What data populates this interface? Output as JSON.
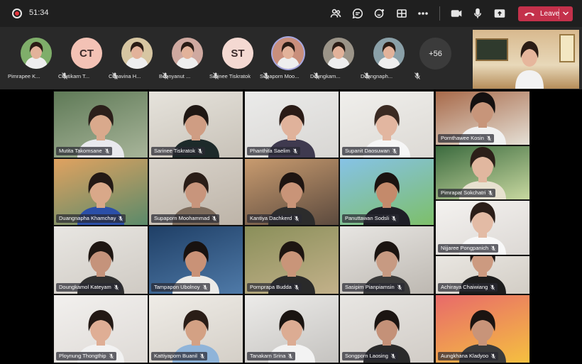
{
  "meeting": {
    "timer": "51:34",
    "leave_label": "Leave",
    "colors": {
      "toolbar_bg": "#1f1f1f",
      "strip_bg": "#292929",
      "leave_red": "#c4314b",
      "active_ring": "#a6a7e0"
    }
  },
  "toolbar": {
    "icons": [
      "participants-icon",
      "chat-icon",
      "reactions-icon",
      "rooms-icon",
      "more-options-icon",
      "camera-icon",
      "mic-icon",
      "share-icon"
    ]
  },
  "roster": {
    "items": [
      {
        "name": "Pimrapee K...",
        "initials": "",
        "avatar_color": "#7fae6a",
        "photo": true
      },
      {
        "name": "Chutikarn T...",
        "initials": "CT",
        "avatar_color": "#f3c2b5",
        "photo": false
      },
      {
        "name": "Chpavina H...",
        "initials": "",
        "avatar_color": "#d7c6a2",
        "photo": true
      },
      {
        "name": "Boonyanut ...",
        "initials": "",
        "avatar_color": "#cfa9a0",
        "photo": true
      },
      {
        "name": "Sarinee Tiskratok",
        "initials": "ST",
        "avatar_color": "#f4d9d2",
        "photo": false
      },
      {
        "name": "Supaporn Moo...",
        "initials": "",
        "avatar_color": "#c98f7c",
        "photo": true,
        "active": true
      },
      {
        "name": "Doungkam...",
        "initials": "",
        "avatar_color": "#9b9488",
        "photo": true
      },
      {
        "name": "Duangnaph...",
        "initials": "",
        "avatar_color": "#8aa0a8",
        "photo": true
      }
    ],
    "more_count": "+56"
  },
  "grid": {
    "tiles": [
      {
        "name": "Mutita Takomsane",
        "bg": "#5f7a57",
        "bg2": "#a8b59a",
        "skin": "#d9a98c",
        "hair": "#2b1f1a",
        "shirt": "#e9e9ee",
        "speaking": true
      },
      {
        "name": "Sarinee Tiskratok",
        "bg": "#e6e3dc",
        "bg2": "#c8c2b8",
        "skin": "#cf9d83",
        "hair": "#1f1713",
        "shirt": "#1d2a2a"
      },
      {
        "name": "Phanthita Saelim",
        "bg": "#ebebea",
        "bg2": "#d8d6d3",
        "skin": "#e0b29b",
        "hair": "#2a1b16",
        "shirt": "#3f3a4f"
      },
      {
        "name": "Supanit Daosuwan",
        "bg": "#f0efec",
        "bg2": "#dcd9d4",
        "skin": "#e2b6a0",
        "hair": "#3a2a22",
        "shirt": "#f6f6f6"
      },
      {
        "name": "Pornthawee Kosin",
        "bg": "#a86a4a",
        "bg2": "#e5e0d6",
        "skin": "#c7957a",
        "hair": "#141010",
        "shirt": "#f1f1f1"
      },
      {
        "name": "Duangnapha Khamchay",
        "bg": "#e0a260",
        "bg2": "#5a8a6a",
        "skin": "#d9a889",
        "hair": "#231915",
        "shirt": "#2b4fa8"
      },
      {
        "name": "Supaporn Moohammad",
        "bg": "#d9d3cb",
        "bg2": "#bdb4a8",
        "skin": "#c8957c",
        "hair": "#2a1d17",
        "shirt": "#7c6b5c"
      },
      {
        "name": "Kantiya Dachkerd",
        "bg": "#c89b6f",
        "bg2": "#5c4a3e",
        "skin": "#c99478",
        "hair": "#1d1411",
        "shirt": "#2c2c2c"
      },
      {
        "name": "Panuttawan Sodsli",
        "bg": "#86c2e6",
        "bg2": "#7dbf69",
        "skin": "#c48a6b",
        "hair": "#1b1310",
        "shirt": "#1e1e26"
      },
      {
        "name": "Pimrapat Sokchatri",
        "bg": "#3c6b3f",
        "bg2": "#c8d8a0",
        "skin": "#e1b79f",
        "hair": "#2c1f19",
        "shirt": "#e7e1cf"
      },
      {
        "name": "Nijjaree Pongpanich",
        "bg": "#f4f2f0",
        "bg2": "#dcd8d4",
        "skin": "#e3bba5",
        "hair": "#2b1e19",
        "shirt": "#f8f8f8"
      },
      {
        "name": "Doungkamol Kateyam",
        "bg": "#e8e6e2",
        "bg2": "#cfcac3",
        "skin": "#c5937b",
        "hair": "#1e1612",
        "shirt": "#303030"
      },
      {
        "name": "Tampapon Ubolnoy",
        "bg": "#1f3f66",
        "bg2": "#4f7aa8",
        "skin": "#c99277",
        "hair": "#181210",
        "shirt": "#ecebe8"
      },
      {
        "name": "Pornprapa Budda",
        "bg": "#8a8f5a",
        "bg2": "#c3b18a",
        "skin": "#c99579",
        "hair": "#1d1511",
        "shirt": "#2a2a2a"
      },
      {
        "name": "Sasipim Pianpiamsin",
        "bg": "#e7e5e2",
        "bg2": "#bdb8b1",
        "skin": "#c79a82",
        "hair": "#1b1411",
        "shirt": "#3a3a3a"
      },
      {
        "name": "Achiraya Chaiwiang",
        "bg": "#e9e6e1",
        "bg2": "#d2cdc5",
        "skin": "#cc9a80",
        "hair": "#1c1411",
        "shirt": "#1d1d1d"
      },
      {
        "name": "Ploynung Thongthip",
        "bg": "#f2f0ee",
        "bg2": "#dedad6",
        "skin": "#dfae95",
        "hair": "#231915",
        "shirt": "#f2f2f2"
      },
      {
        "name": "Kattiyaporn Buanil",
        "bg": "#efece7",
        "bg2": "#d4cfc7",
        "skin": "#d3a184",
        "hair": "#2a1d17",
        "shirt": "#8fb4d9"
      },
      {
        "name": "Tanakarn Srina",
        "bg": "#ecebe9",
        "bg2": "#c5c3c0",
        "skin": "#dcac93",
        "hair": "#1a1411",
        "shirt": "#f3f3f3"
      },
      {
        "name": "Songporn Laosing",
        "bg": "#e8e6e3",
        "bg2": "#d1ccc6",
        "skin": "#c49178",
        "hair": "#1c1512",
        "shirt": "#2a2a2a"
      },
      {
        "name": "Aungkhana Kladyoo",
        "bg": "#e86a6a",
        "bg2": "#f5c040",
        "skin": "#c89479",
        "hair": "#1b1411",
        "shirt": "#3b3b3b"
      }
    ]
  }
}
